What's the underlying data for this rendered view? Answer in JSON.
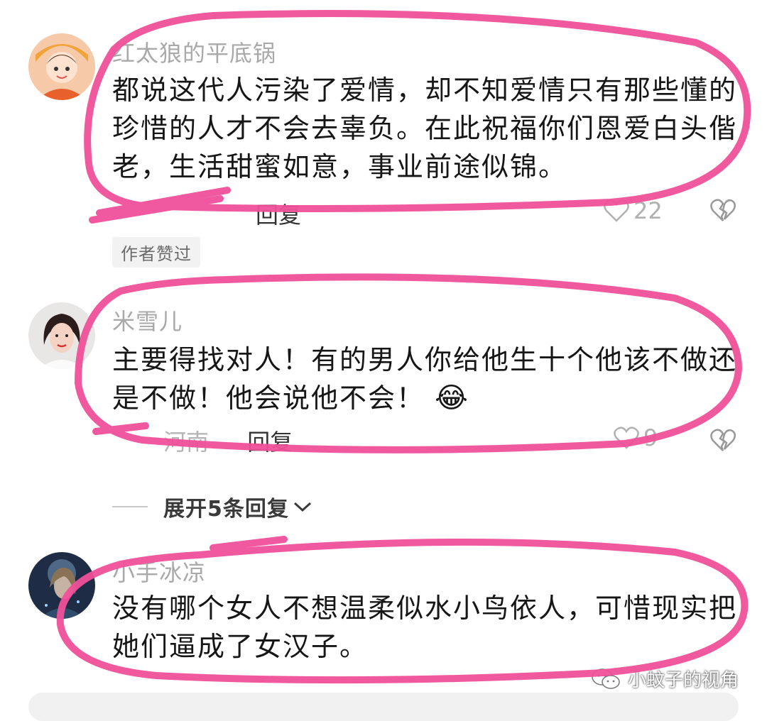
{
  "comments": [
    {
      "username": "红太狼的平底锅",
      "text": "都说这代人污染了爱情，却不知爱情只有那些懂的珍惜的人才不会去辜负。在此祝福你们恩爱白头偕老，生活甜蜜如意，事业前途似锦。",
      "reply_label": "回复",
      "like_count": "22",
      "badge": "作者赞过",
      "avatar_icon": "cartoon-girl-avatar"
    },
    {
      "username": "米雪儿",
      "text": "主要得找对人！有的男人你给他生十个他该不做还是不做！他会说他不会！",
      "emoji": "😂",
      "location": "河南",
      "reply_label": "回复",
      "like_count": "9",
      "avatar_icon": "woman-photo-avatar"
    },
    {
      "username": "小手冰凉",
      "text": "没有哪个女人不想温柔似水小鸟依人，可惜现实把她们逼成了女汉子。",
      "avatar_icon": "fantasy-portrait-avatar"
    }
  ],
  "expand_replies": "展开5条回复",
  "watermark": "小蚊子的视角",
  "colors": {
    "highlight": "#f0509a",
    "username": "#a9a9a9",
    "text": "#161616"
  }
}
